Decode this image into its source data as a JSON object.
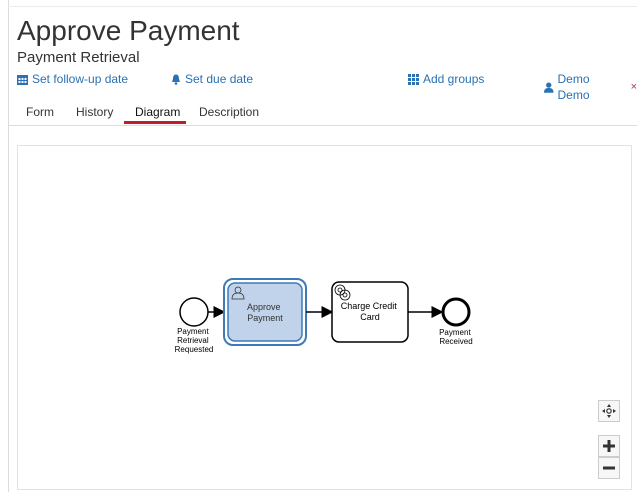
{
  "task": {
    "title": "Approve Payment",
    "process_name": "Payment Retrieval"
  },
  "actions": {
    "follow_up": "Set follow-up date",
    "due_date": "Set due date",
    "add_groups": "Add groups",
    "assignee": "Demo Demo",
    "remove_assignee": "×"
  },
  "tabs": [
    {
      "label": "Form",
      "active": false
    },
    {
      "label": "History",
      "active": false
    },
    {
      "label": "Diagram",
      "active": true
    },
    {
      "label": "Description",
      "active": false
    }
  ],
  "diagram": {
    "start_event": [
      "Payment",
      "Retrieval",
      "Requested"
    ],
    "user_task": [
      "Approve",
      "Payment"
    ],
    "service_task": [
      "Charge Credit",
      "Card"
    ],
    "end_event": [
      "Payment",
      "Received"
    ]
  },
  "colors": {
    "link": "#2b71b3",
    "active_tab": "#c41d2a",
    "highlight_fill": "#c0d3ea",
    "highlight_border": "#3f7ab8"
  },
  "icons": {
    "follow_up": "calendar-icon",
    "due_date": "bell-icon",
    "add_groups": "grid-icon",
    "assignee": "user-icon",
    "reset_zoom": "move-icon",
    "zoom_in": "plus-icon",
    "zoom_out": "minus-icon"
  }
}
